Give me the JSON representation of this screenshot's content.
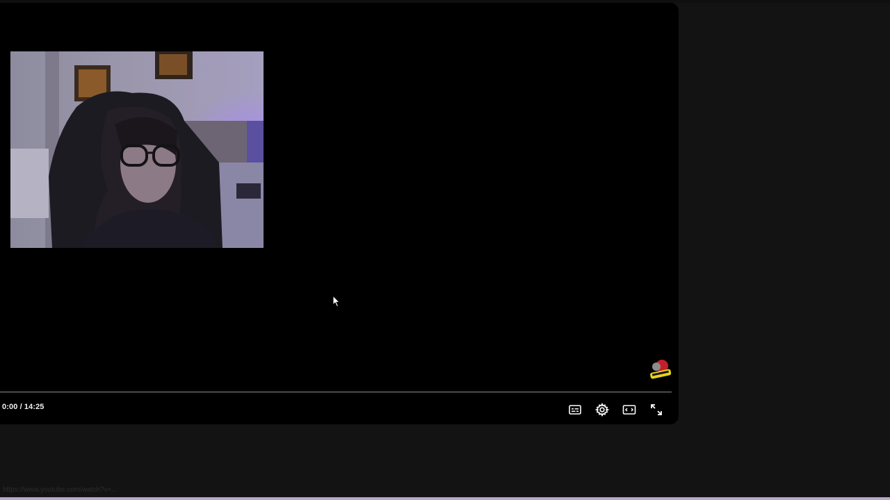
{
  "player": {
    "current_time": "0:00",
    "time_separator": " / ",
    "duration": "14:25",
    "progress_fraction": 0,
    "controls": {
      "subtitles_icon": "subtitles-icon",
      "settings_icon": "gear-icon",
      "theater_icon": "theater-mode-icon",
      "fullscreen_icon": "fullscreen-icon"
    }
  },
  "status_bar": {
    "url": "https://www.youtube.com/watch?v=..."
  },
  "colors": {
    "page_background": "#131314",
    "player_background": "#000000",
    "progress_track": "#3a3a3a",
    "accent_bottom": "#b9a6c9"
  }
}
